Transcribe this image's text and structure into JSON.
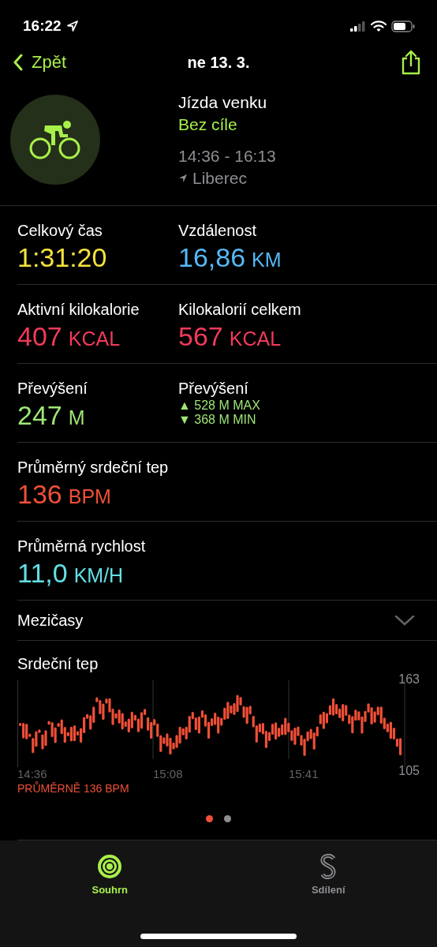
{
  "status_bar": {
    "time": "16:22"
  },
  "nav": {
    "back": "Zpět",
    "title": "ne 13. 3."
  },
  "workout": {
    "name": "Jízda venku",
    "goal": "Bez cíle",
    "time_range": "14:36 - 16:13",
    "location": "Liberec"
  },
  "stats": [
    {
      "cells": [
        {
          "kind": "value",
          "label": "Celkový čas",
          "value": "1:31:20",
          "color": "#f5e23c"
        },
        {
          "kind": "value",
          "label": "Vzdálenost",
          "value": "16,86",
          "unit": "KM",
          "color": "#57b8f5"
        }
      ]
    },
    {
      "cells": [
        {
          "kind": "value",
          "label": "Aktivní kilokalorie",
          "value": "407",
          "unit": "KCAL",
          "color": "#f23a5a"
        },
        {
          "kind": "value",
          "label": "Kilokalorií celkem",
          "value": "567",
          "unit": "KCAL",
          "color": "#f23a5a"
        }
      ]
    },
    {
      "cells": [
        {
          "kind": "value",
          "label": "Převýšení",
          "value": "247",
          "unit": "M",
          "color": "#9ee677"
        },
        {
          "kind": "range",
          "label": "Převýšení",
          "max": "▲ 528 M MAX",
          "min": "▼ 368 M MIN",
          "color": "#9ee677"
        }
      ]
    },
    {
      "cells": [
        {
          "kind": "value",
          "label": "Průměrný srdeční tep",
          "value": "136",
          "unit": "BPM",
          "color": "#f04f37"
        }
      ]
    },
    {
      "cells": [
        {
          "kind": "value",
          "label": "Průměrná rychlost",
          "value": "11,0",
          "unit": "KM/H",
          "color": "#62e0e6"
        }
      ]
    }
  ],
  "splits": {
    "label": "Mezičasy",
    "expanded": false
  },
  "heart_rate": {
    "title": "Srdeční tep",
    "y_max": "163",
    "y_min": "105",
    "x_labels": [
      "14:36",
      "15:08",
      "15:41"
    ],
    "average": "PRŮMĚRNĚ 136 BPM"
  },
  "pages": [
    {
      "selected": true
    },
    {
      "selected": false
    }
  ],
  "tabs": [
    {
      "label": "Souhrn",
      "selected": true
    },
    {
      "label": "Sdílení",
      "selected": false
    }
  ]
}
